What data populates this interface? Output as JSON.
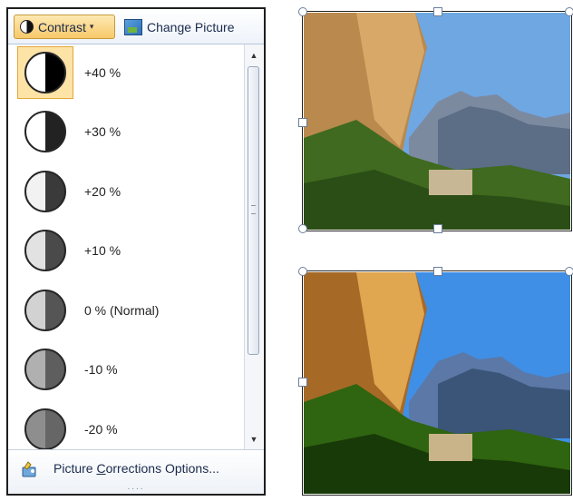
{
  "toolbar": {
    "contrast_label": "Contrast",
    "change_picture_label": "Change Picture"
  },
  "contrast_options": [
    {
      "label": "+40 %",
      "selected": true,
      "light": "#ffffff",
      "dark": "#000000"
    },
    {
      "label": "+30 %",
      "selected": false,
      "light": "#ffffff",
      "dark": "#222222"
    },
    {
      "label": "+20 %",
      "selected": false,
      "light": "#f2f2f2",
      "dark": "#3a3a3a"
    },
    {
      "label": "+10 %",
      "selected": false,
      "light": "#e2e2e2",
      "dark": "#4a4a4a"
    },
    {
      "label": "0 % (Normal)",
      "selected": false,
      "light": "#d2d2d2",
      "dark": "#555555"
    },
    {
      "label": "-10 %",
      "selected": false,
      "light": "#b0b0b0",
      "dark": "#5e5e5e"
    },
    {
      "label": "-20 %",
      "selected": false,
      "light": "#8e8e8e",
      "dark": "#666666"
    }
  ],
  "footer": {
    "options_label": "Picture Corrections Options...",
    "resize_grip": "....",
    "underline_char": "C"
  },
  "colors": {
    "selection_fill": "#fde3a6",
    "selection_border": "#e2a83c",
    "text": "#1a2b4c"
  }
}
